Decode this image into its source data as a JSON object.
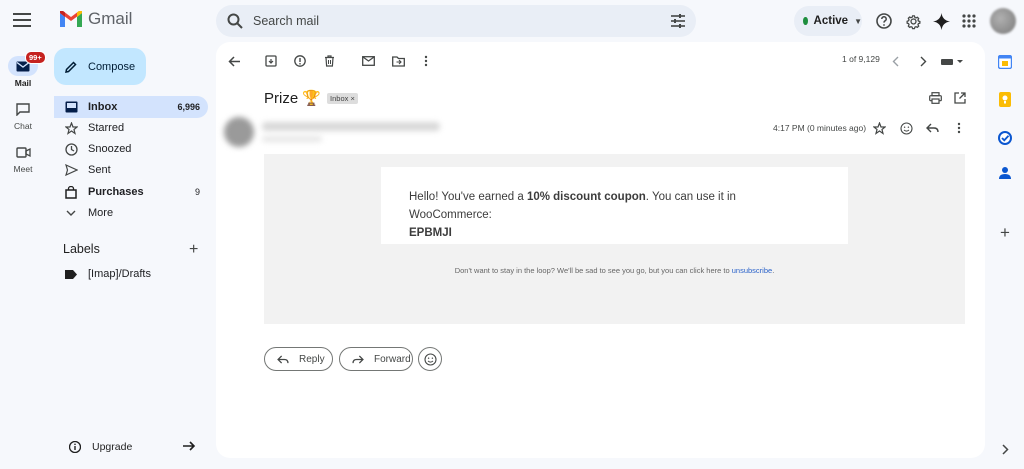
{
  "app": {
    "name": "Gmail"
  },
  "search": {
    "placeholder": "Search mail"
  },
  "status": {
    "label": "Active",
    "color": "#1e8e3e"
  },
  "rail": {
    "items": [
      {
        "label": "Mail",
        "badge": "99+",
        "icon": "mail-icon"
      },
      {
        "label": "Chat",
        "icon": "chat-icon"
      },
      {
        "label": "Meet",
        "icon": "video-icon"
      }
    ]
  },
  "compose": {
    "label": "Compose"
  },
  "nav": {
    "items": [
      {
        "label": "Inbox",
        "count": "6,996",
        "icon": "inbox-icon"
      },
      {
        "label": "Starred",
        "icon": "star-icon"
      },
      {
        "label": "Snoozed",
        "icon": "clock-icon"
      },
      {
        "label": "Sent",
        "icon": "send-icon"
      },
      {
        "label": "Purchases",
        "count": "9",
        "icon": "bag-icon"
      },
      {
        "label": "More",
        "icon": "chevron-down-icon"
      }
    ]
  },
  "labels": {
    "heading": "Labels",
    "items": [
      {
        "label": "[Imap]/Drafts"
      }
    ]
  },
  "upgrade": {
    "label": "Upgrade"
  },
  "toolbar": {
    "pager": "1 of 9,129"
  },
  "message": {
    "subject": "Prize 🏆",
    "chip": "Inbox ×",
    "time": "4:17 PM (0 minutes ago)",
    "body_prefix": "Hello! You've earned a ",
    "body_bold": "10% discount coupon",
    "body_suffix": ". You can use it in WooCommerce:",
    "code": "EPBMJI",
    "footer_text": "Don't want to stay in the loop? We'll be sad to see you go, but you can click here to ",
    "footer_link": "unsubscribe",
    "footer_end": "."
  },
  "actions": {
    "reply": "Reply",
    "forward": "Forward"
  },
  "colors": {
    "accent": "#0b57d0",
    "compose": "#c2e7ff",
    "selected": "#d3e3fd",
    "badge": "#c5221f"
  }
}
